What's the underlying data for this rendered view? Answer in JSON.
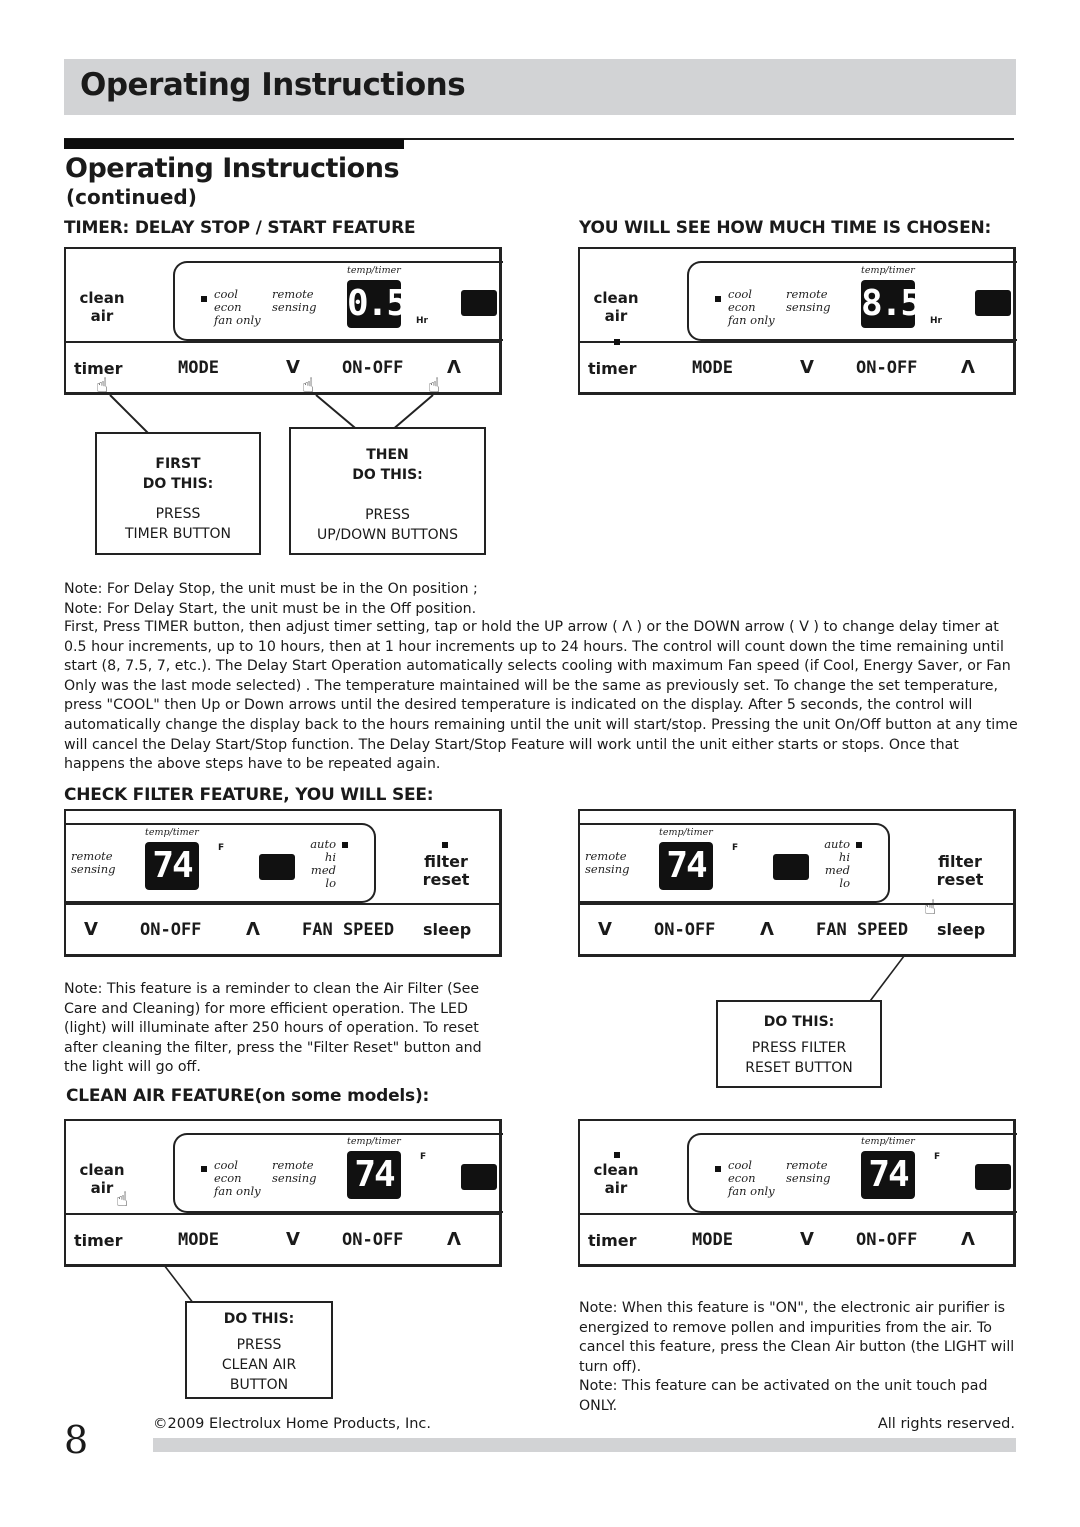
{
  "header": {
    "band_title": "Operating Instructions"
  },
  "page_title": "Operating Instructions",
  "page_subtitle": "(continued)",
  "colors": {
    "band_gray": "#d2d3d5",
    "ink": "#1a1a1a",
    "display_black": "#111111"
  },
  "timer_section": {
    "heading": "TIMER: DELAY STOP / START FEATURE",
    "right_heading": "YOU WILL SEE HOW MUCH TIME IS CHOSEN:",
    "panel_left": {
      "clean_air": [
        "clean",
        "air"
      ],
      "modes": [
        "cool",
        "econ",
        "fan only"
      ],
      "remote_sensing": [
        "remote",
        "sensing"
      ],
      "display_label": "temp/timer",
      "display_value": "0.5",
      "display_unit": "Hr",
      "buttons": {
        "timer": "timer",
        "mode": "MODE",
        "down": "V",
        "onoff": "ON-OFF",
        "up": "Λ"
      }
    },
    "panel_right": {
      "clean_air": [
        "clean",
        "air"
      ],
      "modes": [
        "cool",
        "econ",
        "fan only"
      ],
      "remote_sensing": [
        "remote",
        "sensing"
      ],
      "display_label": "temp/timer",
      "display_value": "8.5",
      "display_unit": "Hr",
      "buttons": {
        "timer": "timer",
        "mode": "MODE",
        "down": "V",
        "onoff": "ON-OFF",
        "up": "Λ"
      }
    },
    "callout_first": {
      "head1": "FIRST",
      "head2": "DO THIS:",
      "line1": "PRESS",
      "line2": "TIMER BUTTON"
    },
    "callout_then": {
      "head1": "THEN",
      "head2": "DO THIS:",
      "line1": "PRESS",
      "line2": "UP/DOWN BUTTONS"
    },
    "note1": "Note: For Delay Stop, the unit must be in the On position ;",
    "note2": "Note: For Delay Start, the unit must be in the Off position.",
    "paragraph": "First, Press TIMER button, then adjust timer setting, tap or hold the UP arrow ( Λ ) or the DOWN arrow ( V ) to change delay timer at 0.5 hour increments, up to 10 hours, then at 1 hour increments up to 24 hours. The control will count down the time remaining until start (8, 7.5, 7, etc.). The Delay Start Operation automatically selects cooling with maximum Fan speed (if Cool, Energy Saver, or Fan Only was the last mode selected) . The temperature maintained will be the same as previously set. To change the set temperature, press \"COOL\" then Up or Down arrows until the desired temperature is indicated on the display. After 5 seconds, the control will automatically change the display back to the hours remaining until the unit will start/stop. Pressing the unit On/Off button at any time will cancel the Delay Start/Stop function. The Delay Start/Stop Feature will work until the unit either starts or stops. Once that happens the above steps have to be repeated again."
  },
  "filter_section": {
    "heading": "CHECK FILTER FEATURE, YOU WILL SEE:",
    "panel": {
      "remote_sensing": [
        "remote",
        "sensing"
      ],
      "display_label": "temp/timer",
      "display_value": "74",
      "display_unit": "F",
      "fan_levels": [
        "auto",
        "hi",
        "med",
        "lo"
      ],
      "filter_reset": [
        "filter",
        "reset"
      ],
      "buttons": {
        "down": "V",
        "onoff": "ON-OFF",
        "up": "Λ",
        "fan_speed": "FAN SPEED",
        "sleep": "sleep"
      }
    },
    "callout": {
      "head": "DO THIS:",
      "line1": "PRESS FILTER",
      "line2": "RESET BUTTON"
    },
    "note": "Note: This feature is a reminder to clean the Air Filter (See Care and Cleaning) for more efficient operation. The LED (light) will illuminate after 250 hours of operation. To reset after cleaning the filter, press the \"Filter Reset\" button and the light will go off."
  },
  "clean_air_section": {
    "heading": "CLEAN AIR FEATURE(on some models):",
    "panel": {
      "clean_air": [
        "clean",
        "air"
      ],
      "modes": [
        "cool",
        "econ",
        "fan only"
      ],
      "remote_sensing": [
        "remote",
        "sensing"
      ],
      "display_label": "temp/timer",
      "display_value": "74",
      "display_unit": "F",
      "buttons": {
        "timer": "timer",
        "mode": "MODE",
        "down": "V",
        "onoff": "ON-OFF",
        "up": "Λ"
      }
    },
    "callout": {
      "head": "DO THIS:",
      "line1": "PRESS",
      "line2": "CLEAN AIR",
      "line3": "BUTTON"
    },
    "note1": "Note: When this feature is \"ON\", the electronic air purifier is energized to remove pollen and impurities from the air. To cancel this feature, press the Clean Air button (the LIGHT will turn off).",
    "note2": "Note: This feature can be activated on the unit touch pad ONLY."
  },
  "footer": {
    "page_number": "8",
    "copyright": "©2009 Electrolux Home Products, Inc.",
    "rights": "All rights reserved."
  }
}
